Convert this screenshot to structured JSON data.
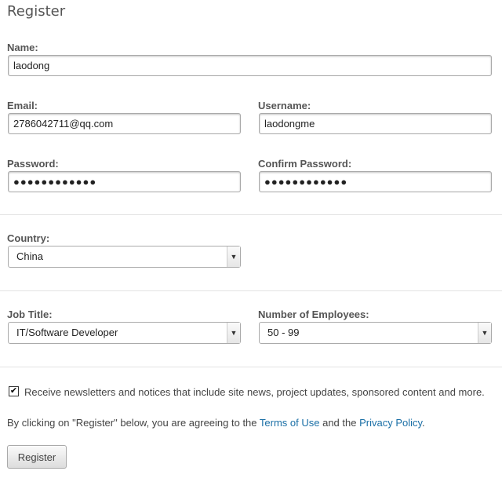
{
  "title": "Register",
  "name": {
    "label": "Name:",
    "value": "laodong"
  },
  "email": {
    "label": "Email:",
    "value": "2786042711@qq.com"
  },
  "username": {
    "label": "Username:",
    "value": "laodongme"
  },
  "password": {
    "label": "Password:",
    "value": "●●●●●●●●●●●●"
  },
  "confirm_password": {
    "label": "Confirm Password:",
    "value": "●●●●●●●●●●●●"
  },
  "country": {
    "label": "Country:",
    "value": "China"
  },
  "job_title": {
    "label": "Job Title:",
    "value": "IT/Software Developer"
  },
  "employees": {
    "label": "Number of Employees:",
    "value": "50 - 99"
  },
  "newsletter": {
    "checked": true,
    "label": "Receive newsletters and notices that include site news, project updates, sponsored content and more."
  },
  "agreement": {
    "prefix": "By clicking on \"Register\" below, you are agreeing to the ",
    "terms": "Terms of Use",
    "middle": " and the ",
    "privacy": "Privacy Policy",
    "suffix": "."
  },
  "register_button": "Register"
}
